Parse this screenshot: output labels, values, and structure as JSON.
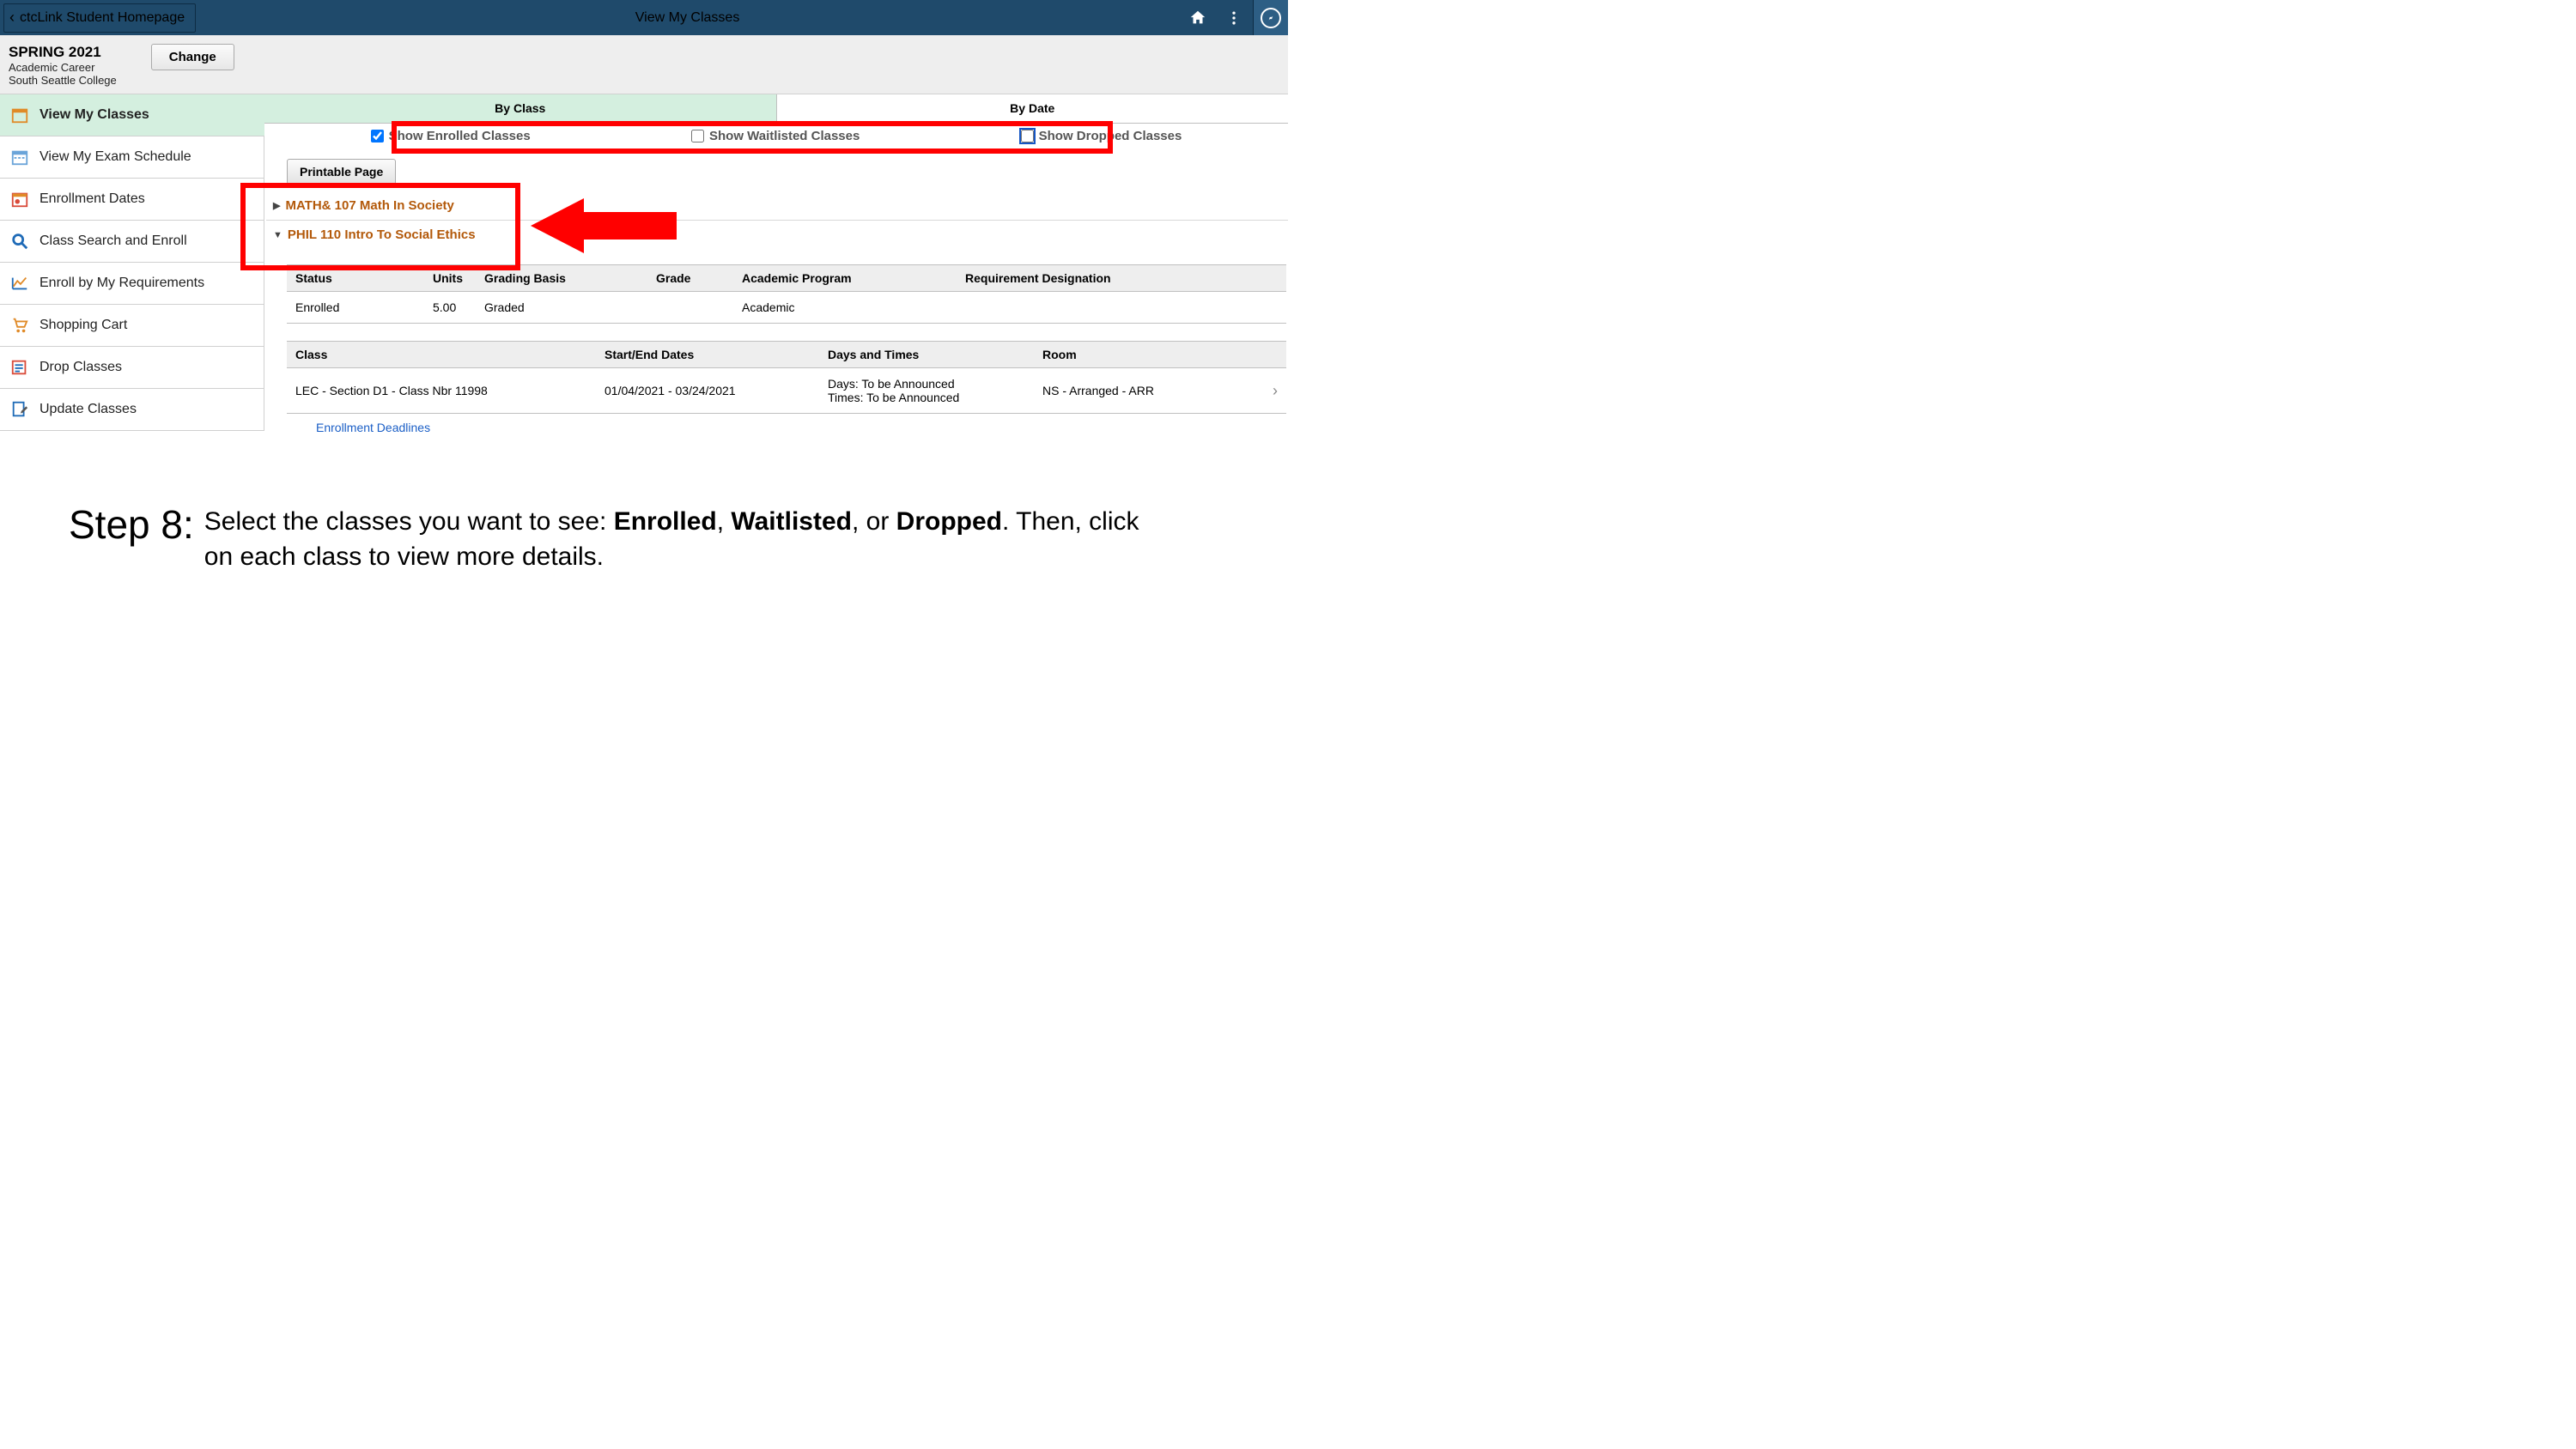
{
  "banner": {
    "back_label": "ctcLink Student Homepage",
    "title": "View My Classes"
  },
  "term": {
    "label": "SPRING 2021",
    "career": "Academic Career",
    "college": "South Seattle College",
    "change_label": "Change"
  },
  "sidebar": {
    "items": [
      {
        "label": "View My Classes"
      },
      {
        "label": "View My Exam Schedule"
      },
      {
        "label": "Enrollment Dates"
      },
      {
        "label": "Class Search and Enroll"
      },
      {
        "label": "Enroll by My Requirements"
      },
      {
        "label": "Shopping Cart"
      },
      {
        "label": "Drop Classes"
      },
      {
        "label": "Update Classes"
      }
    ]
  },
  "tabs": {
    "by_class": "By Class",
    "by_date": "By Date"
  },
  "filters": {
    "enrolled": "Show Enrolled Classes",
    "waitlisted": "Show Waitlisted Classes",
    "dropped": "Show Dropped Classes"
  },
  "buttons": {
    "printable": "Printable Page"
  },
  "classes": [
    {
      "title": "MATH& 107 Math In Society",
      "expanded": false
    },
    {
      "title": "PHIL 110 Intro To Social Ethics",
      "expanded": true
    }
  ],
  "enroll_table": {
    "headers": {
      "status": "Status",
      "units": "Units",
      "grading": "Grading Basis",
      "grade": "Grade",
      "program": "Academic Program",
      "req": "Requirement Designation"
    },
    "row": {
      "status": "Enrolled",
      "units": "5.00",
      "grading": "Graded",
      "grade": "",
      "program": "Academic",
      "req": ""
    }
  },
  "sched_table": {
    "headers": {
      "class": "Class",
      "dates": "Start/End Dates",
      "days": "Days and Times",
      "room": "Room"
    },
    "row": {
      "class": "LEC - Section D1 - Class Nbr 11998",
      "dates": "01/04/2021 - 03/24/2021",
      "days_line1": "Days: To be Announced",
      "days_line2": "Times: To be Announced",
      "room": "NS - Arranged - ARR"
    }
  },
  "links": {
    "deadlines": "Enrollment Deadlines"
  },
  "caption": {
    "step": "Step 8:",
    "t1": "Select the classes you want to see: ",
    "b1": "Enrolled",
    "t2": ", ",
    "b2": "Waitlisted",
    "t3": ", or ",
    "b3": "Dropped",
    "t4": ". Then, click on each class to view more details."
  }
}
